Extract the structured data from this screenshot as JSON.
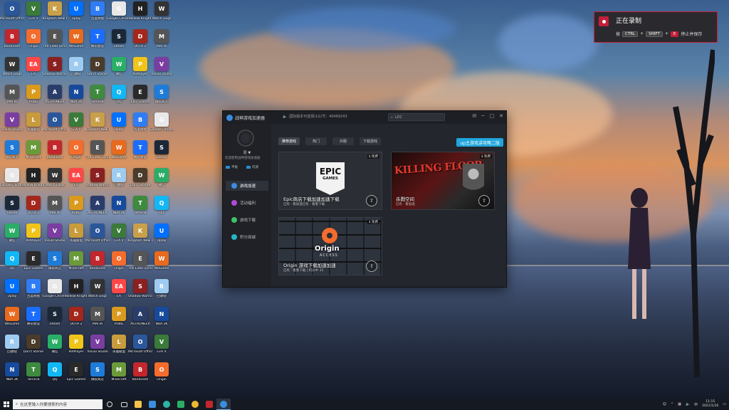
{
  "desktop": {
    "icons": [
      {
        "label": "Microsoft Office",
        "color": "#2b579a",
        "glyph": "O"
      },
      {
        "label": "Bandicam",
        "color": "#c1272d",
        "glyph": "B"
      },
      {
        "label": "Watch Dogs",
        "color": "#333333",
        "glyph": "W"
      },
      {
        "label": "MAFIA",
        "color": "#555555",
        "glyph": "M"
      },
      {
        "label": "Visual Studio",
        "color": "#7a3ea1",
        "glyph": "V"
      },
      {
        "label": "微软商店",
        "color": "#1f7bd8",
        "glyph": "S"
      },
      {
        "label": "Google Chrome",
        "color": "#e8e8e8",
        "glyph": "G"
      },
      {
        "label": "Steam",
        "color": "#1b2838",
        "glyph": "S"
      },
      {
        "label": "微信",
        "color": "#2aae67",
        "glyph": "W"
      },
      {
        "label": "QQ",
        "color": "#12b7f5",
        "glyph": "Q"
      },
      {
        "label": "Uplay",
        "color": "#0070ff",
        "glyph": "U"
      },
      {
        "label": "WeGame",
        "color": "#e86a1e",
        "glyph": "W"
      },
      {
        "label": "回收站",
        "color": "#9ecbf0",
        "glyph": "R"
      },
      {
        "label": "NBA 2K",
        "color": "#174a9c",
        "glyph": "N"
      },
      {
        "label": "GTA V",
        "color": "#3a7a3a",
        "glyph": "V"
      },
      {
        "label": "Origin",
        "color": "#f56c2d",
        "glyph": "O"
      },
      {
        "label": "EA",
        "color": "#ff4747",
        "glyph": "EA"
      },
      {
        "label": "PUBG",
        "color": "#d99a1e",
        "glyph": "P"
      },
      {
        "label": "英雄联盟",
        "color": "#c89b3c",
        "glyph": "L"
      },
      {
        "label": "Minecraft",
        "color": "#6a9a3a",
        "glyph": "M"
      },
      {
        "label": "Hollow Knight",
        "color": "#222222",
        "glyph": "H"
      },
      {
        "label": "DOTA 2",
        "color": "#a4271c",
        "glyph": "D"
      },
      {
        "label": "PotPlayer",
        "color": "#f0c419",
        "glyph": "P"
      },
      {
        "label": "Epic Games",
        "color": "#2a2a2a",
        "glyph": "E"
      },
      {
        "label": "百度网盘",
        "color": "#2f7df6",
        "glyph": "B"
      },
      {
        "label": "腾讯会议",
        "color": "#1a6dff",
        "glyph": "T"
      },
      {
        "label": "Don't Starve",
        "color": "#4a3b2a",
        "glyph": "D"
      },
      {
        "label": "Terraria",
        "color": "#3e8a3e",
        "glyph": "T"
      },
      {
        "label": "Kingdom New Lands",
        "color": "#c9a04a",
        "glyph": "K"
      },
      {
        "label": "The Elder Scrolls",
        "color": "#555555",
        "glyph": "E"
      },
      {
        "label": "Shadow Warrior",
        "color": "#8a2020",
        "glyph": "S"
      },
      {
        "label": "ASTRONEER",
        "color": "#2a3d6a",
        "glyph": "A"
      }
    ]
  },
  "recording": {
    "title": "正在录制",
    "hint_prefix": "按",
    "key1": "CTRL",
    "key2": "SHIFT",
    "key3": "E",
    "hint_suffix": "停止并保存",
    "accent": "#c31f3a"
  },
  "app": {
    "title": "战神游戏加速器",
    "status_text": "国际版本可选择(1G)节：40469243",
    "search_placeholder": "LDC",
    "win_buttons": [
      "✉",
      "─",
      "□",
      "✕"
    ],
    "user": {
      "name": "原 ▼",
      "subtitle": "欢迎使用战神游戏加速器",
      "btn_left": "平板",
      "btn_right": "内测"
    },
    "nav": [
      {
        "label": "游戏加速",
        "color": "#3a8de0",
        "active": true
      },
      {
        "label": "活动福利",
        "color": "#b04ad6",
        "active": false
      },
      {
        "label": "游戏下载",
        "color": "#3ec16a",
        "active": false
      },
      {
        "label": "积分商城",
        "color": "#28b4c8",
        "active": false
      }
    ],
    "tabs": [
      {
        "label": "推荐游戏",
        "active": true
      },
      {
        "label": "热门",
        "active": false
      },
      {
        "label": "外服",
        "active": false
      },
      {
        "label": "下载游戏",
        "active": false
      }
    ],
    "promo": "up主游戏讲攻略二版",
    "cards": {
      "epic": {
        "tag": "$ 免费",
        "logo_line1": "EPIC",
        "logo_line2": "GAMES",
        "title": "Epic商店下载加速加速下载",
        "sub": "已有 · 看加速已有 · 看看下载"
      },
      "kf": {
        "tag": "$ 免费",
        "banner": "KILLING FLOOR",
        "title": "杀戮空间",
        "sub": "已有 · 看加速"
      },
      "origin": {
        "tag": "$ 免费",
        "name": "Origin",
        "access": "ACCESS",
        "title": "Origin 游戏下载加速加速",
        "sub": "已有 · 看看下载 | 积分中 35"
      }
    }
  },
  "taskbar": {
    "search_placeholder": "在这里输入你要搜索的内容",
    "time": "11:15",
    "date": "2021/1/16"
  }
}
